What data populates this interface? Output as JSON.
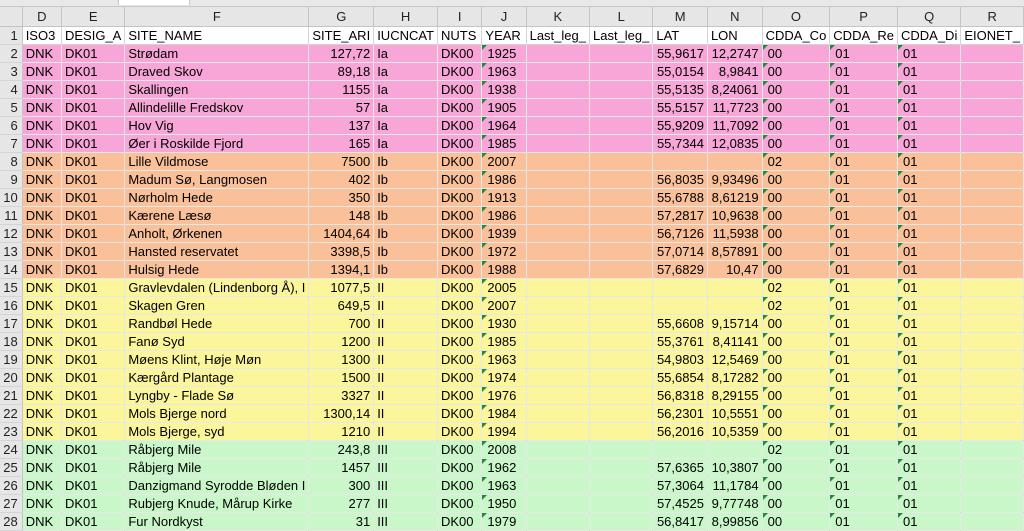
{
  "columns": [
    "D",
    "E",
    "F",
    "G",
    "H",
    "I",
    "J",
    "K",
    "L",
    "M",
    "N",
    "O",
    "P",
    "Q",
    "R"
  ],
  "rows": [
    {
      "n": "1",
      "cat": "hdr",
      "c": [
        "ISO3",
        "DESIG_A",
        "SITE_NAME",
        "SITE_ARI",
        "IUCNCAT",
        "NUTS",
        "YEAR",
        "Last_leg_",
        "Last_leg_",
        "LAT",
        "LON",
        "CDDA_Co",
        "CDDA_Re",
        "CDDA_Di",
        "EIONET_"
      ]
    },
    {
      "n": "2",
      "cat": "Ia",
      "c": [
        "DNK",
        "DK01",
        "Strødam",
        "127,72",
        "Ia",
        "DK00",
        "1925",
        "",
        "",
        "55,9617",
        "12,2747",
        "00",
        "01",
        "01",
        ""
      ]
    },
    {
      "n": "3",
      "cat": "Ia",
      "c": [
        "DNK",
        "DK01",
        "Draved Skov",
        "89,18",
        "Ia",
        "DK00",
        "1963",
        "",
        "",
        "55,0154",
        "8,9841",
        "00",
        "01",
        "01",
        ""
      ]
    },
    {
      "n": "4",
      "cat": "Ia",
      "c": [
        "DNK",
        "DK01",
        "Skallingen",
        "1155",
        "Ia",
        "DK00",
        "1938",
        "",
        "",
        "55,5135",
        "8,24061",
        "00",
        "01",
        "01",
        ""
      ]
    },
    {
      "n": "5",
      "cat": "Ia",
      "c": [
        "DNK",
        "DK01",
        "Allindelille Fredskov",
        "57",
        "Ia",
        "DK00",
        "1905",
        "",
        "",
        "55,5157",
        "11,7723",
        "00",
        "01",
        "01",
        ""
      ]
    },
    {
      "n": "6",
      "cat": "Ia",
      "c": [
        "DNK",
        "DK01",
        "Hov Vig",
        "137",
        "Ia",
        "DK00",
        "1964",
        "",
        "",
        "55,9209",
        "11,7092",
        "00",
        "01",
        "01",
        ""
      ]
    },
    {
      "n": "7",
      "cat": "Ia",
      "c": [
        "DNK",
        "DK01",
        "Øer i Roskilde Fjord",
        "165",
        "Ia",
        "DK00",
        "1985",
        "",
        "",
        "55,7344",
        "12,0835",
        "00",
        "01",
        "01",
        ""
      ]
    },
    {
      "n": "8",
      "cat": "Ib",
      "c": [
        "DNK",
        "DK01",
        "Lille Vildmose",
        "7500",
        "Ib",
        "DK00",
        "2007",
        "",
        "",
        "",
        "",
        "02",
        "01",
        "01",
        ""
      ]
    },
    {
      "n": "9",
      "cat": "Ib",
      "c": [
        "DNK",
        "DK01",
        "Madum Sø, Langmosen",
        "402",
        "Ib",
        "DK00",
        "1986",
        "",
        "",
        "56,8035",
        "9,93496",
        "00",
        "01",
        "01",
        ""
      ]
    },
    {
      "n": "10",
      "cat": "Ib",
      "c": [
        "DNK",
        "DK01",
        "Nørholm Hede",
        "350",
        "Ib",
        "DK00",
        "1913",
        "",
        "",
        "55,6788",
        "8,61219",
        "00",
        "01",
        "01",
        ""
      ]
    },
    {
      "n": "11",
      "cat": "Ib",
      "c": [
        "DNK",
        "DK01",
        "Kærene Læsø",
        "148",
        "Ib",
        "DK00",
        "1986",
        "",
        "",
        "57,2817",
        "10,9638",
        "00",
        "01",
        "01",
        ""
      ]
    },
    {
      "n": "12",
      "cat": "Ib",
      "c": [
        "DNK",
        "DK01",
        "Anholt, Ørkenen",
        "1404,64",
        "Ib",
        "DK00",
        "1939",
        "",
        "",
        "56,7126",
        "11,5938",
        "00",
        "01",
        "01",
        ""
      ]
    },
    {
      "n": "13",
      "cat": "Ib",
      "c": [
        "DNK",
        "DK01",
        "Hansted reservatet",
        "3398,5",
        "Ib",
        "DK00",
        "1972",
        "",
        "",
        "57,0714",
        "8,57891",
        "00",
        "01",
        "01",
        ""
      ]
    },
    {
      "n": "14",
      "cat": "Ib",
      "c": [
        "DNK",
        "DK01",
        "Hulsig Hede",
        "1394,1",
        "Ib",
        "DK00",
        "1988",
        "",
        "",
        "57,6829",
        "10,47",
        "00",
        "01",
        "01",
        ""
      ]
    },
    {
      "n": "15",
      "cat": "II",
      "c": [
        "DNK",
        "DK01",
        "Gravlevdalen (Lindenborg Å), I",
        "1077,5",
        "II",
        "DK00",
        "2005",
        "",
        "",
        "",
        "",
        "02",
        "01",
        "01",
        ""
      ]
    },
    {
      "n": "16",
      "cat": "II",
      "c": [
        "DNK",
        "DK01",
        "Skagen Gren",
        "649,5",
        "II",
        "DK00",
        "2007",
        "",
        "",
        "",
        "",
        "02",
        "01",
        "01",
        ""
      ]
    },
    {
      "n": "17",
      "cat": "II",
      "c": [
        "DNK",
        "DK01",
        "Randbøl Hede",
        "700",
        "II",
        "DK00",
        "1930",
        "",
        "",
        "55,6608",
        "9,15714",
        "00",
        "01",
        "01",
        ""
      ]
    },
    {
      "n": "18",
      "cat": "II",
      "c": [
        "DNK",
        "DK01",
        "Fanø Syd",
        "1200",
        "II",
        "DK00",
        "1985",
        "",
        "",
        "55,3761",
        "8,41141",
        "00",
        "01",
        "01",
        ""
      ]
    },
    {
      "n": "19",
      "cat": "II",
      "c": [
        "DNK",
        "DK01",
        "Møens Klint, Høje Møn",
        "1300",
        "II",
        "DK00",
        "1963",
        "",
        "",
        "54,9803",
        "12,5469",
        "00",
        "01",
        "01",
        ""
      ]
    },
    {
      "n": "20",
      "cat": "II",
      "c": [
        "DNK",
        "DK01",
        "Kærgård Plantage",
        "1500",
        "II",
        "DK00",
        "1974",
        "",
        "",
        "55,6854",
        "8,17282",
        "00",
        "01",
        "01",
        ""
      ]
    },
    {
      "n": "21",
      "cat": "II",
      "c": [
        "DNK",
        "DK01",
        "Lyngby - Flade Sø",
        "3327",
        "II",
        "DK00",
        "1976",
        "",
        "",
        "56,8318",
        "8,29155",
        "00",
        "01",
        "01",
        ""
      ]
    },
    {
      "n": "22",
      "cat": "II",
      "c": [
        "DNK",
        "DK01",
        "Mols Bjerge nord",
        "1300,14",
        "II",
        "DK00",
        "1984",
        "",
        "",
        "56,2301",
        "10,5551",
        "00",
        "01",
        "01",
        ""
      ]
    },
    {
      "n": "23",
      "cat": "II",
      "c": [
        "DNK",
        "DK01",
        "Mols Bjerge, syd",
        "1210",
        "II",
        "DK00",
        "1994",
        "",
        "",
        "56,2016",
        "10,5359",
        "00",
        "01",
        "01",
        ""
      ]
    },
    {
      "n": "24",
      "cat": "III",
      "c": [
        "DNK",
        "DK01",
        "Råbjerg Mile",
        "243,8",
        "III",
        "DK00",
        "2008",
        "",
        "",
        "",
        "",
        "02",
        "01",
        "01",
        ""
      ]
    },
    {
      "n": "25",
      "cat": "III",
      "c": [
        "DNK",
        "DK01",
        "Råbjerg Mile",
        "1457",
        "III",
        "DK00",
        "1962",
        "",
        "",
        "57,6365",
        "10,3807",
        "00",
        "01",
        "01",
        ""
      ]
    },
    {
      "n": "26",
      "cat": "III",
      "c": [
        "DNK",
        "DK01",
        "Danzigmand Syrodde Bløden I",
        "300",
        "III",
        "DK00",
        "1963",
        "",
        "",
        "57,3064",
        "11,1784",
        "00",
        "01",
        "01",
        ""
      ]
    },
    {
      "n": "27",
      "cat": "III",
      "c": [
        "DNK",
        "DK01",
        "Rubjerg Knude, Mårup Kirke",
        "277",
        "III",
        "DK00",
        "1950",
        "",
        "",
        "57,4525",
        "9,77748",
        "00",
        "01",
        "01",
        ""
      ]
    },
    {
      "n": "28",
      "cat": "III",
      "c": [
        "DNK",
        "DK01",
        "Fur Nordkyst",
        "31",
        "III",
        "DK00",
        "1979",
        "",
        "",
        "56,8417",
        "8,99856",
        "00",
        "01",
        "01",
        ""
      ]
    }
  ],
  "colors": {
    "Ia": "#f8a6d7",
    "Ib": "#f9c09a",
    "II": "#fbf59b",
    "III": "#c9f7c9",
    "header": "#e6e6e6",
    "flag": "#1f8a3a"
  }
}
